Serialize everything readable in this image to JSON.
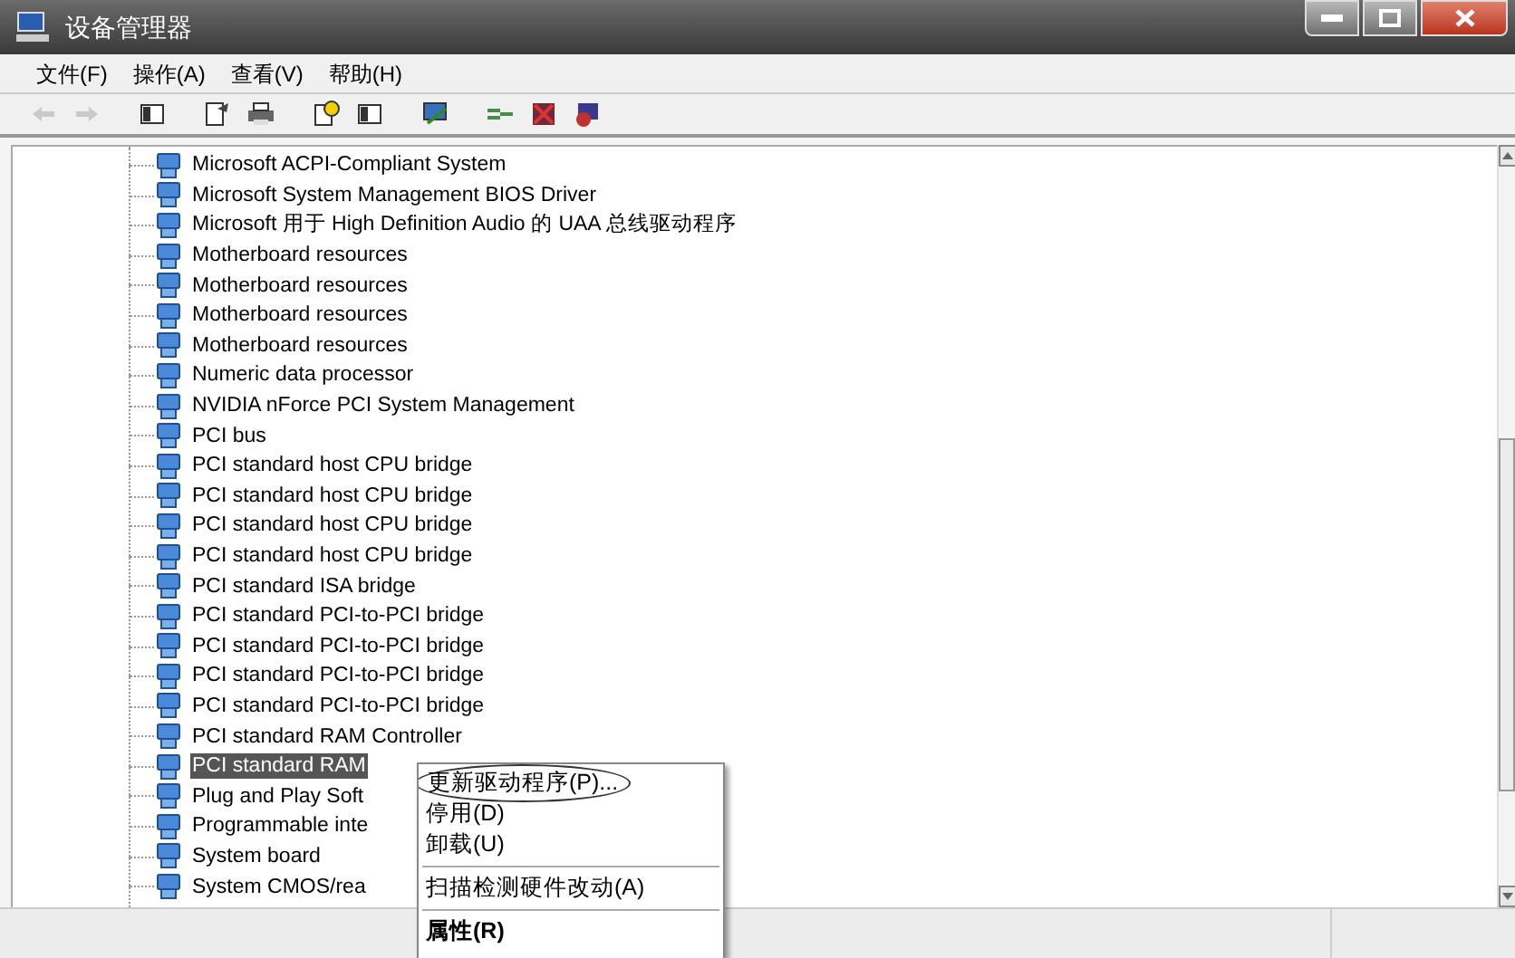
{
  "window": {
    "title": "设备管理器"
  },
  "menu": [
    {
      "label": "文件(F)"
    },
    {
      "label": "操作(A)"
    },
    {
      "label": "查看(V)"
    },
    {
      "label": "帮助(H)"
    }
  ],
  "toolbar": [
    {
      "kind": "back",
      "disabled": true
    },
    {
      "kind": "forward",
      "disabled": true
    },
    {
      "kind": "sep"
    },
    {
      "kind": "pane",
      "disabled": false
    },
    {
      "kind": "sep"
    },
    {
      "kind": "properties",
      "disabled": false
    },
    {
      "kind": "print",
      "disabled": false
    },
    {
      "kind": "sep"
    },
    {
      "kind": "help",
      "disabled": false
    },
    {
      "kind": "pane",
      "disabled": false
    },
    {
      "kind": "sep"
    },
    {
      "kind": "scan",
      "disabled": false
    },
    {
      "kind": "sep"
    },
    {
      "kind": "update",
      "disabled": false
    },
    {
      "kind": "uninstall",
      "disabled": false
    },
    {
      "kind": "disable",
      "disabled": false
    }
  ],
  "tree": {
    "items": [
      {
        "label": "Microsoft ACPI-Compliant System",
        "selected": false
      },
      {
        "label": "Microsoft System Management BIOS Driver",
        "selected": false
      },
      {
        "label": "Microsoft 用于 High Definition Audio 的 UAA 总线驱动程序",
        "selected": false
      },
      {
        "label": "Motherboard resources",
        "selected": false
      },
      {
        "label": "Motherboard resources",
        "selected": false
      },
      {
        "label": "Motherboard resources",
        "selected": false
      },
      {
        "label": "Motherboard resources",
        "selected": false
      },
      {
        "label": "Numeric data processor",
        "selected": false
      },
      {
        "label": "NVIDIA nForce PCI System Management",
        "selected": false
      },
      {
        "label": "PCI bus",
        "selected": false
      },
      {
        "label": "PCI standard host CPU bridge",
        "selected": false
      },
      {
        "label": "PCI standard host CPU bridge",
        "selected": false
      },
      {
        "label": "PCI standard host CPU bridge",
        "selected": false
      },
      {
        "label": "PCI standard host CPU bridge",
        "selected": false
      },
      {
        "label": "PCI standard ISA bridge",
        "selected": false
      },
      {
        "label": "PCI standard PCI-to-PCI bridge",
        "selected": false
      },
      {
        "label": "PCI standard PCI-to-PCI bridge",
        "selected": false
      },
      {
        "label": "PCI standard PCI-to-PCI bridge",
        "selected": false
      },
      {
        "label": "PCI standard PCI-to-PCI bridge",
        "selected": false
      },
      {
        "label": "PCI standard RAM Controller",
        "selected": false
      },
      {
        "label": "PCI standard RAM",
        "selected": true
      },
      {
        "label": "Plug and Play Soft",
        "selected": false
      },
      {
        "label": "Programmable inte",
        "selected": false
      },
      {
        "label": "System board",
        "selected": false
      },
      {
        "label": "System CMOS/rea",
        "selected": false
      }
    ]
  },
  "context_menu": [
    {
      "kind": "item",
      "label": "更新驱动程序(P)...",
      "circled": true
    },
    {
      "kind": "item",
      "label": "停用(D)",
      "circled": false
    },
    {
      "kind": "item",
      "label": "卸载(U)",
      "circled": false
    },
    {
      "kind": "separator"
    },
    {
      "kind": "item",
      "label": "扫描检测硬件改动(A)",
      "circled": false
    },
    {
      "kind": "separator"
    },
    {
      "kind": "default",
      "label": "属性(R)",
      "circled": false
    }
  ]
}
